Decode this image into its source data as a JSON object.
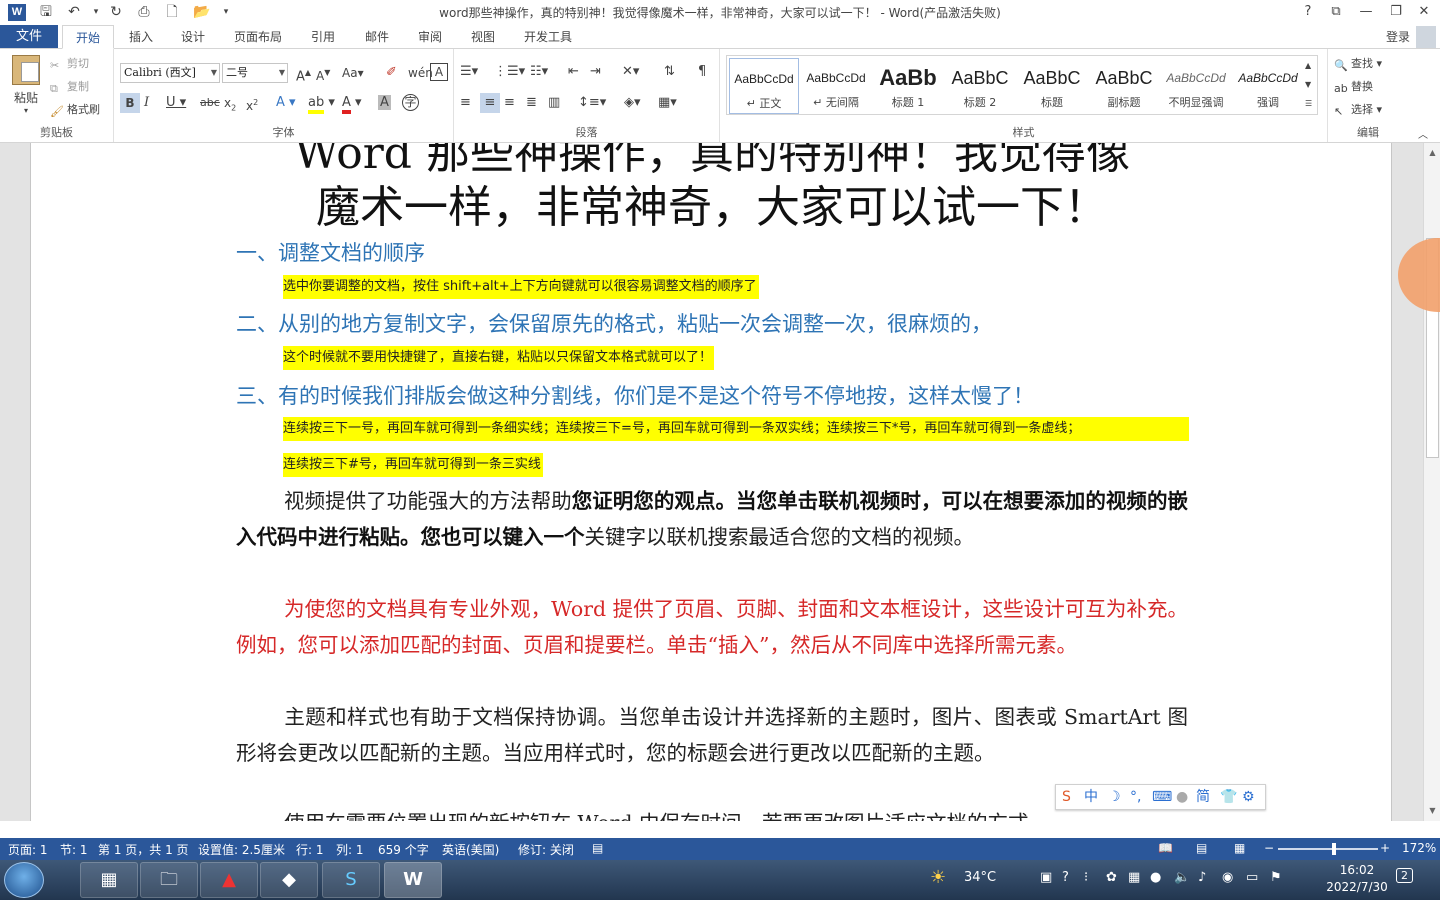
{
  "window": {
    "title": "word那些神操作，真的特别神！我觉得像魔术一样，非常神奇，大家可以试一下！ - Word(产品激活失败)",
    "help": "?",
    "buttons": [
      "⧉",
      "—",
      "❐",
      "✕"
    ]
  },
  "tabs": {
    "file": "文件",
    "items": [
      "开始",
      "插入",
      "设计",
      "页面布局",
      "引用",
      "邮件",
      "审阅",
      "视图",
      "开发工具"
    ],
    "active": "开始",
    "login": "登录"
  },
  "ribbon": {
    "clipboard": {
      "paste": "粘贴",
      "cut": "剪切",
      "copy": "复制",
      "format_painter": "格式刷",
      "label": "剪贴板"
    },
    "font": {
      "name": "Calibri (西文]",
      "size": "二号",
      "label": "字体"
    },
    "paragraph": {
      "label": "段落"
    },
    "styles": {
      "label": "样式",
      "items": [
        {
          "sample": "AaBbCcDd",
          "name": "↵ 正文"
        },
        {
          "sample": "AaBbCcDd",
          "name": "↵ 无间隔"
        },
        {
          "sample": "AaBb",
          "name": "标题 1"
        },
        {
          "sample": "AaBbC",
          "name": "标题 2"
        },
        {
          "sample": "AaBbC",
          "name": "标题"
        },
        {
          "sample": "AaBbC",
          "name": "副标题"
        },
        {
          "sample": "AaBbCcDd",
          "name": "不明显强调"
        },
        {
          "sample": "AaBbCcDd",
          "name": "强调"
        }
      ]
    },
    "editing": {
      "find": "查找",
      "replace": "替换",
      "select": "选择",
      "label": "编辑"
    }
  },
  "document": {
    "title_partial": "Word 那些神操作，真的特别神！我觉得像",
    "title_line2": "魔术一样，非常神奇，大家可以试一下！",
    "h1": "一、调整文档的顺序",
    "hl1": "选中你要调整的文档，按住 shift+alt+上下方向键就可以很容易调整文档的顺序了",
    "h2": "二、从别的地方复制文字，会保留原先的格式，粘贴一次会调整一次，很麻烦的，",
    "hl2": "这个时候就不要用快捷键了，直接右键，粘贴以只保留文本格式就可以了！",
    "h3": "三、有的时候我们排版会做这种分割线，你们是不是这个符号不停地按，这样太慢了！",
    "hl3a": "连续按三下一号，再回车就可得到一条细实线；连续按三下=号，再回车就可得到一条双实线；连续按三下*号，再回车就可得到一条虚线；",
    "hl3b": "连续按三下#号，再回车就可得到一条三实线",
    "p1_a": "视频提供了功能强大的方法帮助",
    "p1_b": "您证明您的观点。当您单击联机视频时，可以在想要添加的视频的嵌入代码中进行粘贴。您也可以键入一个",
    "p1_c": "关键字以联机搜索最适合您的文档的视频。",
    "p2": "为使您的文档具有专业外观，Word 提供了页眉、页脚、封面和文本框设计，这些设计可互为补充。例如，您可以添加匹配的封面、页眉和提要栏。单击“插入”，然后从不同库中选择所需元素。",
    "p3": "主题和样式也有助于文档保持协调。当您单击设计并选择新的主题时，图片、图表或 SmartArt 图形将会更改以匹配新的主题。当应用样式时，您的标题会进行更改以匹配新的主题。",
    "p4_partial": "使用在需要位置出现的新按钮在 Word 中保存时间。若要更改图片适应文档的方式，"
  },
  "ime": {
    "items": [
      "中",
      "简"
    ]
  },
  "status": {
    "page": "页面: 1",
    "section": "节: 1",
    "pageof": "第 1 页，共 1 页",
    "setting": "设置值: 2.5厘米",
    "row": "行: 1",
    "col": "列: 1",
    "words": "659 个字",
    "lang": "英语(美国)",
    "track": "修订: 关闭",
    "zoom": "172%"
  },
  "taskbar": {
    "weather": "34°C",
    "time": "16:02",
    "date": "2022/7/30",
    "notif": "2"
  },
  "colors": {
    "accent": "#2b579a",
    "heading": "#2e74b5",
    "highlight": "#ffff00",
    "red_text": "#d62828"
  }
}
